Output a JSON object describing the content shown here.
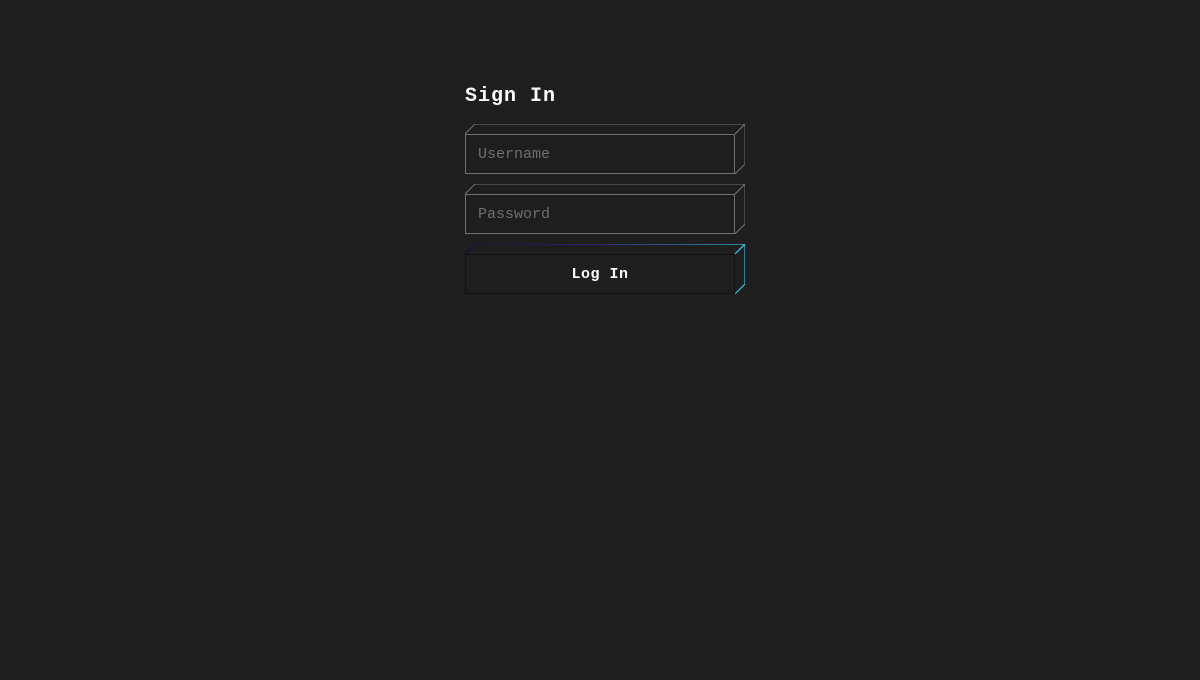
{
  "form": {
    "title": "Sign In",
    "username_placeholder": "Username",
    "password_placeholder": "Password",
    "submit_label": "Log In"
  },
  "colors": {
    "gradient_start": "#3b1c9c",
    "gradient_end": "#34c6e7",
    "outline": "#717171"
  }
}
